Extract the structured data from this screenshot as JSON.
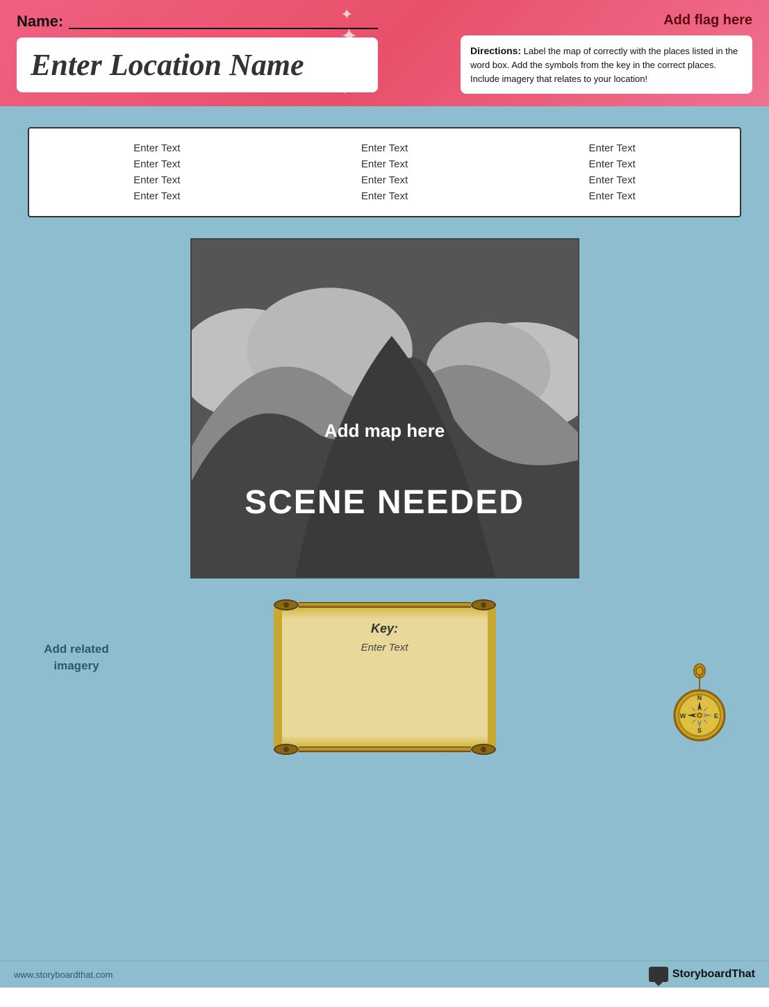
{
  "header": {
    "name_label": "Name:",
    "location_name": "Enter Location Name",
    "flag_label": "Add flag here",
    "directions_title": "Directions:",
    "directions_body": " Label the map of  correctly with the places listed in the word box.  Add the symbols from the key in the correct places. Include imagery that relates to your location!"
  },
  "word_box": {
    "columns": [
      [
        "Enter Text",
        "Enter Text",
        "Enter Text",
        "Enter Text"
      ],
      [
        "Enter Text",
        "Enter Text",
        "Enter Text",
        "Enter Text"
      ],
      [
        "Enter Text",
        "Enter Text",
        "Enter Text",
        "Enter Text"
      ]
    ]
  },
  "map": {
    "add_map_label": "Add map here",
    "scene_needed_label": "SCENE NEEDED"
  },
  "imagery_label": "Add related imagery",
  "key": {
    "title": "Key:",
    "text": "Enter Text"
  },
  "compass_label": "compass",
  "footer": {
    "url": "www.storyboardthat.com",
    "brand": "StoryboardThat"
  }
}
